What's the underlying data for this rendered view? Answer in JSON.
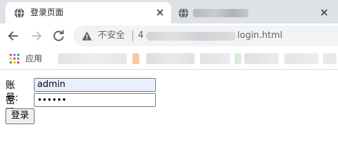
{
  "browser": {
    "active_tab": {
      "title": "登录页面",
      "close_icon": "close-icon"
    },
    "inactive_tab": {
      "close_icon": "close-icon"
    },
    "toolbar": {
      "back_icon": "arrow-left-icon",
      "forward_icon": "arrow-right-icon",
      "reload_icon": "reload-icon"
    },
    "omnibox": {
      "security_icon": "info-icon",
      "security_text": "不安全",
      "url_prefix": "4",
      "url_path": "login.html"
    },
    "bookmarks": {
      "apps_icon": "apps-grid-icon",
      "apps_label": "应用"
    }
  },
  "page": {
    "username_label": "账号:",
    "username_value": "admin",
    "password_label": "密码:",
    "password_mask": "••••••",
    "submit_label": "登录"
  },
  "colors": {
    "tabstrip": "#dee1e6",
    "omnibox": "#f1f3f4",
    "autofill": "#e8f0fe",
    "button": "#efefef"
  }
}
